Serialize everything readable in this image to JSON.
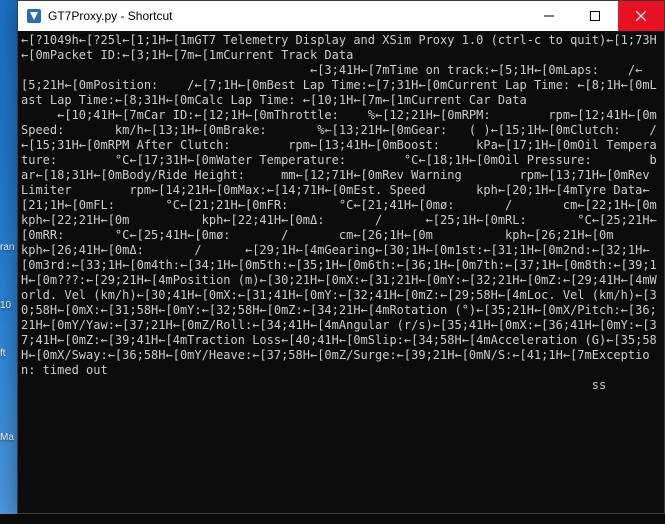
{
  "desktop": {
    "label1": "ran",
    "label2": "10",
    "label3": "ft",
    "label4": "Ma"
  },
  "window": {
    "title": "GT7Proxy.py - Shortcut"
  },
  "console_text": "←[?1049h←[?25l←[1;1H←[1mGT7 Telemetry Display and XSim Proxy 1.0 (ctrl-c to quit)←[1;73H←[0mPacket ID:←[3;1H←[7m←[1mCurrent Track Data\n                                        ←[3;41H←[7mTime on track:←[5;1H←[0mLaps:    /←[5;21H←[0mPosition:    /←[7;1H←[0mBest Lap Time:←[7;31H←[0mCurrent Lap Time: ←[8;1H←[0mLast Lap Time:←[8;31H←[0mCalc Lap Time: ←[10;1H←[7m←[1mCurrent Car Data\n     ←[10;41H←[7mCar ID:←[12;1H←[0mThrottle:    %←[12;21H←[0mRPM:        rpm←[12;41H←[0mSpeed:       km/h←[13;1H←[0mBrake:       %←[13;21H←[0mGear:   ( )←[15;1H←[0mClutch:    /←[15;31H←[0mRPM After Clutch:        rpm←[13;41H←[0mBoost:     kPa←[17;1H←[0mOil Temperature:        °C←[17;31H←[0mWater Temperature:        °C←[18;1H←[0mOil Pressure:        bar←[18;31H←[0mBody/Ride Height:     mm←[12;71H←[0mRev Warning        rpm←[13;71H←[0mRev Limiter        rpm←[14;21H←[0mMax:←[14;71H←[0mEst. Speed       kph←[20;1H←[4mTyre Data←[21;1H←[0mFL:       °C←[21;21H←[0mFR:       °C←[21;41H←[0mø:       /       cm←[22;1H←[0m          kph←[22;21H←[0m          kph←[22;41H←[0mΔ:       /      ←[25;1H←[0mRL:       °C←[25;21H←[0mRR:       °C←[25;41H←[0mø:       /       cm←[26;1H←[0m          kph←[26;21H←[0m          kph←[26;41H←[0mΔ:       /      ←[29;1H←[4mGearing←[30;1H←[0m1st:←[31;1H←[0m2nd:←[32;1H←[0m3rd:←[33;1H←[0m4th:←[34;1H←[0m5th:←[35;1H←[0m6th:←[36;1H←[0m7th:←[37;1H←[0m8th:←[39;1H←[0m???:←[29;21H←[4mPosition (m)←[30;21H←[0mX:←[31;21H←[0mY:←[32;21H←[0mZ:←[29;41H←[4mWorld. Vel (km/h)←[30;41H←[0mX:←[31;41H←[0mY:←[32;41H←[0mZ:←[29;58H←[4mLoc. Vel (km/h)←[30;58H←[0mX:←[31;58H←[0mY:←[32;58H←[0mZ:←[34;21H←[4mRotation (°)←[35;21H←[0mX/Pitch:←[36;21H←[0mY/Yaw:←[37;21H←[0mZ/Roll:←[34;41H←[4mAngular (r/s)←[35;41H←[0mX:←[36;41H←[0mY:←[37;41H←[0mZ:←[39;41H←[4mTraction Loss←[40;41H←[0mSlip:←[34;58H←[4mAcceleration (G)←[35;58H←[0mX/Sway:←[36;58H←[0mY/Heave:←[37;58H←[0mZ/Surge:←[39;21H←[0mN/S:←[41;1H←[7mException: timed out\n                                                                               ss"
}
